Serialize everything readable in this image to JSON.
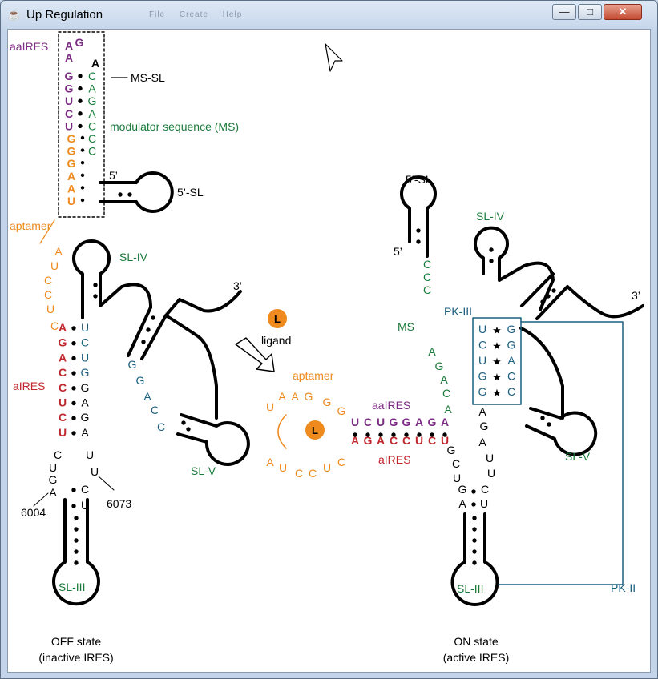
{
  "window": {
    "title": "Up Regulation",
    "ghost_menu": "File Create Help",
    "minimize": "—",
    "maximize": "□",
    "close": "✕"
  },
  "colors": {
    "purple": "#7b2b83",
    "green": "#1a7a3a",
    "orange": "#ef8a1e",
    "red": "#c0272d",
    "blue": "#1b5e80",
    "black": "#000000"
  },
  "icons": {
    "app": "java-cup-icon",
    "cursor": "arrow-cursor-icon",
    "ligand": "ligand-L-icon",
    "arrow": "hollow-arrow-icon"
  },
  "labels": {
    "aaIRES_top": "aaIRES",
    "ms_sl": "MS-SL",
    "modulator": "modulator sequence (MS)",
    "five_prime_left": "5’",
    "five_sl_left": "5’-SL",
    "aptamer_left": "aptamer",
    "sl_iv_left": "SL-IV",
    "three_prime_left": "3’",
    "aIRES_left": "aIRES",
    "sl_v_left": "SL-V",
    "n6004": "6004",
    "n6073": "6073",
    "sl_iii_left": "SL-III",
    "off_state": "OFF state",
    "off_sub": "(inactive IRES)",
    "ligand_L": "L",
    "ligand": "ligand",
    "aptamer_mid": "aptamer",
    "aaIRES_mid": "aaIRES",
    "aIRES_mid": "aIRES",
    "ligand_L_mid": "L",
    "five_sl_right": "5’-SL",
    "five_prime_right": "5’",
    "sl_iv_right": "SL-IV",
    "three_prime_right": "3’",
    "ms_right": "MS",
    "pk_iii": "PK-III",
    "sl_v_right": "SL-V",
    "sl_iii_right": "SL-III",
    "pk_ii": "PK-II",
    "on_state": "ON state",
    "on_sub": "(active IRES)"
  },
  "sequences": {
    "top_loop": [
      "A",
      "G",
      "A",
      "A"
    ],
    "ms_left": [
      "G",
      "G",
      "U",
      "C",
      "U",
      "G",
      "G",
      "G",
      "A",
      "A",
      "U"
    ],
    "ms_right": [
      "C",
      "A",
      "G",
      "A",
      "C",
      "C",
      "C"
    ],
    "aptamer_left": [
      "A",
      "U",
      "C",
      "C",
      "U",
      "C"
    ],
    "off_left": [
      "A",
      "G",
      "A",
      "C",
      "C",
      "U",
      "C",
      "U"
    ],
    "off_right": [
      "U",
      "C",
      "U",
      "G",
      "G",
      "A",
      "G",
      "A"
    ],
    "off_bottom_left": [
      "C",
      "U",
      "G",
      "A"
    ],
    "off_bottom_right": [
      "U",
      "U",
      "C",
      "U"
    ],
    "gg_acc": [
      "G",
      "G",
      "A",
      "C",
      "C"
    ],
    "apt_mid_top": [
      "U",
      "A",
      "A",
      "G",
      "G",
      "G"
    ],
    "apt_mid_bottom": [
      "A",
      "U",
      "C",
      "C",
      "U",
      "C"
    ],
    "aaires_mid": [
      "U",
      "C",
      "U",
      "G",
      "G",
      "A",
      "G",
      "A"
    ],
    "aires_mid": [
      "A",
      "G",
      "A",
      "C",
      "C",
      "U",
      "C",
      "U"
    ],
    "right_ms": [
      "C",
      "C",
      "C"
    ],
    "right_agaca": [
      "A",
      "G",
      "A",
      "C",
      "A"
    ],
    "pk_left": [
      "U",
      "C",
      "U",
      "G",
      "G"
    ],
    "pk_right": [
      "G",
      "G",
      "A",
      "C",
      "C"
    ],
    "right_down_left": [
      "G",
      "C",
      "U",
      "G",
      "A"
    ],
    "right_down_right": [
      "A",
      "G",
      "A",
      "U",
      "U",
      "C",
      "U"
    ]
  }
}
